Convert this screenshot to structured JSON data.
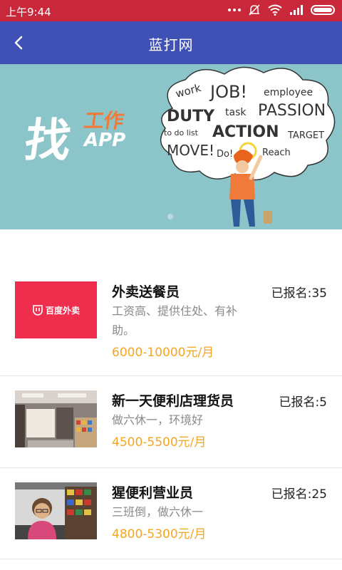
{
  "status_bar": {
    "time": "上午9:44"
  },
  "app_bar": {
    "title": "蓝打网"
  },
  "banner": {
    "title_main": "找",
    "title_sub": "工作",
    "title_app": "APP",
    "cloud_words": [
      "work",
      "JOB!",
      "employee",
      "DUTY",
      "task",
      "PASSION",
      "to do list",
      "ACTION",
      "TARGET",
      "MOVE!",
      "Do!",
      "Reach"
    ]
  },
  "jobs": [
    {
      "title": "外卖送餐员",
      "signed": "已报名:35",
      "desc": "工资高、提供住处、有补助。",
      "salary": "6000-10000元/月",
      "thumb_text": "百度外卖"
    },
    {
      "title": "新一天便利店理货员",
      "signed": "已报名:5",
      "desc": "做六休一，环境好",
      "salary": "4500-5500元/月"
    },
    {
      "title": "猩便利营业员",
      "signed": "已报名:25",
      "desc": "三班倒，做六休一",
      "salary": "4800-5300元/月"
    }
  ],
  "colors": {
    "status_bar": "#c8283a",
    "app_bar": "#3f51b5",
    "salary": "#f5a623",
    "banner": "#8cc5c9"
  }
}
